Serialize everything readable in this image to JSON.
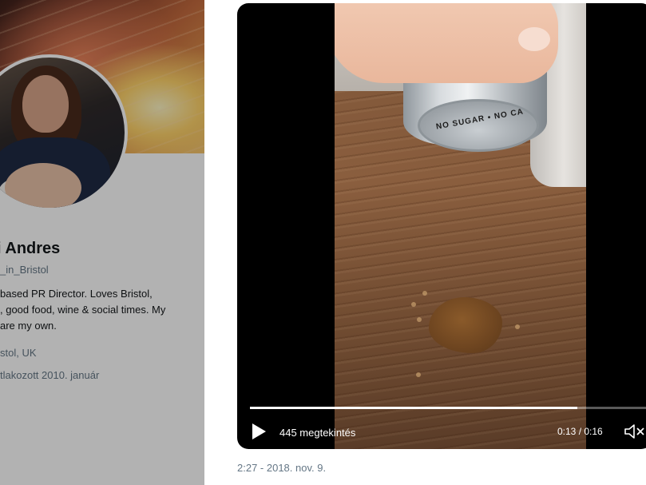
{
  "profile": {
    "name": "i Andres",
    "handle": "_in_Bristol",
    "bio_lines": [
      "based PR Director. Loves Bristol,",
      ", good food, wine & social times. My",
      "are my own."
    ],
    "location": "stol, UK",
    "joined": "tlakozott 2010. január"
  },
  "video": {
    "can_text": "NO SUGAR • NO CA",
    "progress": 0.8125,
    "views_label": "445 megtekintés",
    "time_label": "0:13 / 0:16",
    "play_icon": "play-icon",
    "mute_icon": "muted-speaker-icon"
  },
  "tweet": {
    "timestamp": "2:27 - 2018. nov. 9."
  },
  "colors": {
    "secondary_text": "#657786",
    "primary_text": "#14171a",
    "video_bg": "#000000"
  }
}
